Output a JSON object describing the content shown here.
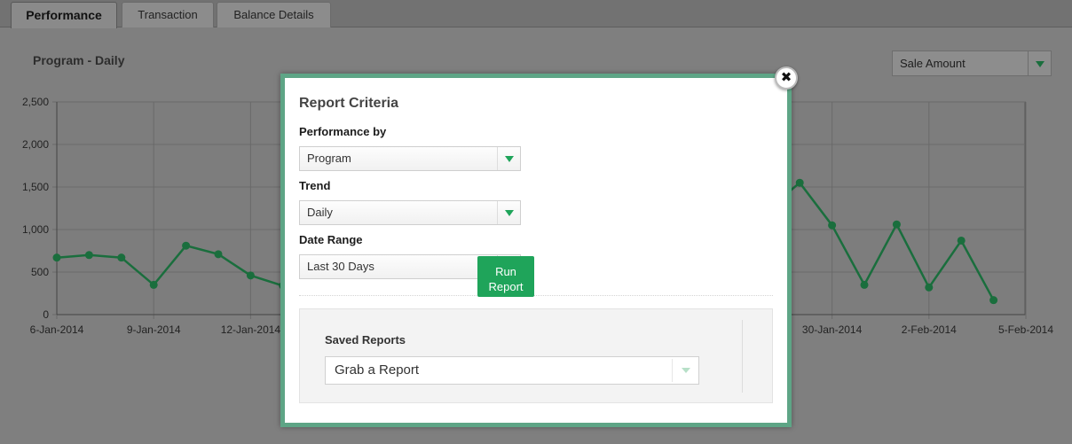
{
  "tabs": [
    {
      "label": "Performance",
      "active": true
    },
    {
      "label": "Transaction",
      "active": false
    },
    {
      "label": "Balance Details",
      "active": false
    }
  ],
  "chart_title": "Program - Daily",
  "metric_select": {
    "value": "Sale Amount"
  },
  "chart_data": {
    "type": "line",
    "title": "Program - Daily",
    "xlabel": "",
    "ylabel": "",
    "ylim": [
      0,
      2500
    ],
    "yticks": [
      "2,500",
      "2,000",
      "1,500",
      "1,000",
      "500",
      "0"
    ],
    "xticks": [
      "6-Jan-2014",
      "9-Jan-2014",
      "12-Jan-2014",
      "30-Jan-2014",
      "2-Feb-2014",
      "5-Feb-2014"
    ],
    "grid": true,
    "series": [
      {
        "color": "#1a6e3d",
        "points_visible_left": [
          {
            "x": "6-Jan-2014",
            "y": 670
          },
          {
            "x": "7-Jan-2014",
            "y": 700
          },
          {
            "x": "8-Jan-2014",
            "y": 670
          },
          {
            "x": "9-Jan-2014",
            "y": 350
          },
          {
            "x": "10-Jan-2014",
            "y": 810
          },
          {
            "x": "11-Jan-2014",
            "y": 710
          },
          {
            "x": "12-Jan-2014",
            "y": 460
          },
          {
            "x": "13-Jan-2014",
            "y": 340
          }
        ],
        "points_visible_right": [
          {
            "x": "28-Jan-2014",
            "y": 1230
          },
          {
            "x": "29-Jan-2014",
            "y": 1550
          },
          {
            "x": "30-Jan-2014",
            "y": 1050
          },
          {
            "x": "31-Jan-2014",
            "y": 350
          },
          {
            "x": "1-Feb-2014",
            "y": 1060
          },
          {
            "x": "2-Feb-2014",
            "y": 320
          },
          {
            "x": "3-Feb-2014",
            "y": 870
          },
          {
            "x": "4-Feb-2014",
            "y": 170
          }
        ]
      }
    ]
  },
  "modal": {
    "title": "Report Criteria",
    "performance_by": {
      "label": "Performance by",
      "value": "Program"
    },
    "trend": {
      "label": "Trend",
      "value": "Daily"
    },
    "date_range": {
      "label": "Date Range",
      "value": "Last 30 Days"
    },
    "saved_reports": {
      "label": "Saved Reports",
      "value": "Grab a Report"
    },
    "run_button": "Run\nReport",
    "close_icon": "close-icon",
    "close_glyph": "✖"
  },
  "colors": {
    "accent": "#1fa45a",
    "modal_border": "#5ea586",
    "line": "#1a6e3d"
  }
}
